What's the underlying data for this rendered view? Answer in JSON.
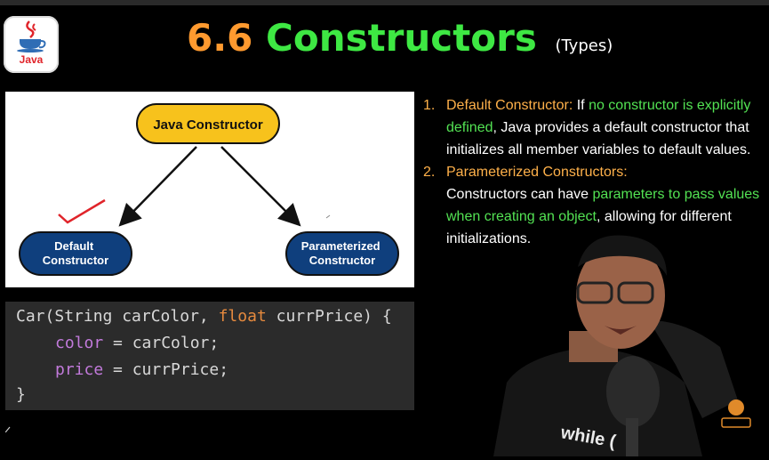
{
  "logo": {
    "label": "Java"
  },
  "title": {
    "number": "6.6",
    "text": "Constructors",
    "subtitle": "(Types)"
  },
  "diagram": {
    "root": "Java Constructor",
    "left": [
      "Default",
      "Constructor"
    ],
    "right": [
      "Parameterized",
      "Constructor"
    ]
  },
  "code": {
    "line1": {
      "cls": "Car",
      "p1": "(String carColor, ",
      "kw": "float",
      "p2": " currPrice) {"
    },
    "line2": {
      "field": "color",
      "rest": " = carColor;"
    },
    "line3": {
      "field": "price",
      "rest": " = currPrice;"
    },
    "line4": "}"
  },
  "list": {
    "item1": {
      "number": "1.",
      "title": "Default Constructor:",
      "t1": " If ",
      "g1": "no constructor is explicitly defined",
      "t2": ", Java provides a default constructor that initializes all member variables to default values."
    },
    "item2": {
      "number": "2.",
      "title": "Parameterized Constructors:",
      "t1": "Constructors can have ",
      "g1": "parameters to pass values when creating an object",
      "t2": ", allowing for different initializations."
    }
  },
  "overlay": {
    "shirt_text": "while ("
  },
  "colors": {
    "green": "#3ee843",
    "orange": "#ff9a2f",
    "node_blue": "#0f3f7d",
    "node_yellow": "#f7c21c"
  }
}
